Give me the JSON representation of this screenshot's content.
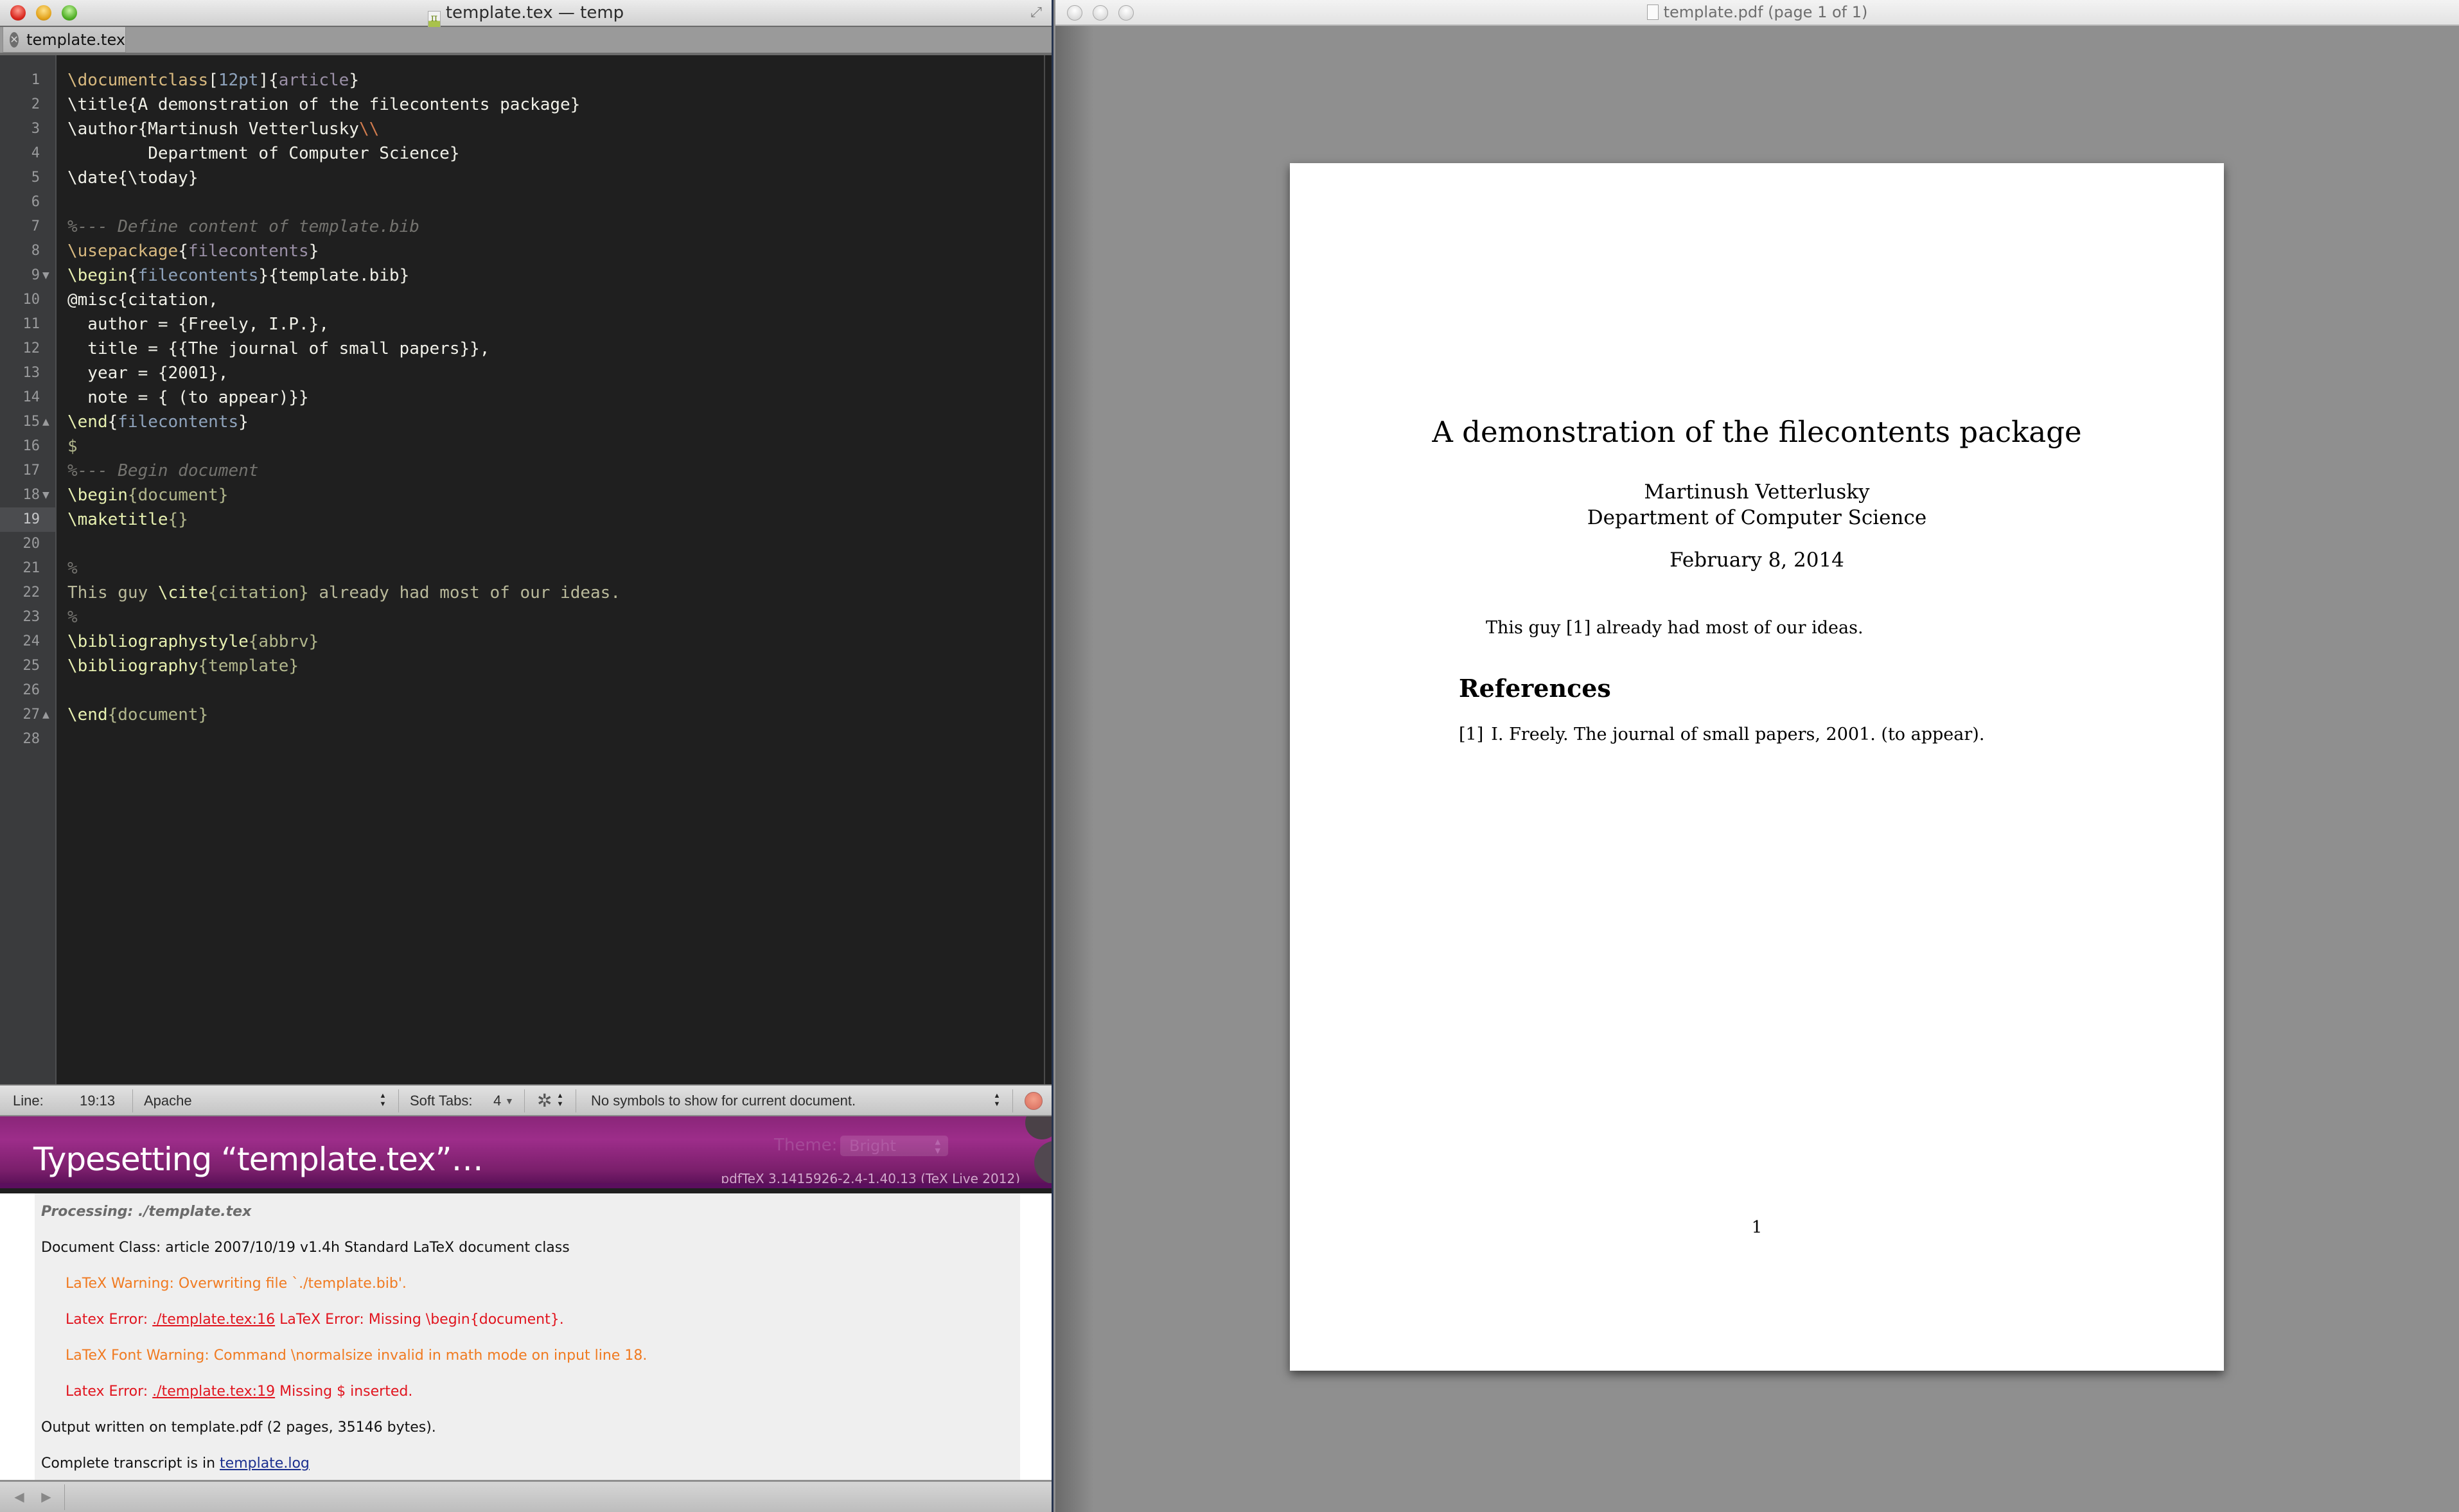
{
  "editor": {
    "window_title": "template.tex — temp",
    "tab_label": "template.tex",
    "active_line": 19,
    "lines": [
      {
        "n": 1,
        "fold": "",
        "parts": [
          [
            "k",
            "\\documentclass"
          ],
          [
            "",
            "["
          ],
          [
            "num",
            "12pt"
          ],
          [
            "",
            "]{"
          ],
          [
            "arg",
            "article"
          ],
          [
            "",
            "}"
          ]
        ]
      },
      {
        "n": 2,
        "fold": "",
        "parts": [
          [
            "",
            "\\title{A demonstration of the filecontents package}"
          ]
        ]
      },
      {
        "n": 3,
        "fold": "",
        "parts": [
          [
            "",
            "\\author{Martinush Vetterlusky"
          ],
          [
            "esc",
            "\\\\"
          ]
        ]
      },
      {
        "n": 4,
        "fold": "",
        "parts": [
          [
            "",
            "        Department of Computer Science}"
          ]
        ]
      },
      {
        "n": 5,
        "fold": "",
        "parts": [
          [
            "",
            "\\date{\\today}"
          ]
        ]
      },
      {
        "n": 6,
        "fold": "",
        "parts": []
      },
      {
        "n": 7,
        "fold": "",
        "parts": [
          [
            "cm",
            "%--- Define content of template.bib"
          ]
        ]
      },
      {
        "n": 8,
        "fold": "",
        "parts": [
          [
            "k",
            "\\usepackage"
          ],
          [
            "",
            "{"
          ],
          [
            "arg",
            "filecontents"
          ],
          [
            "",
            "}"
          ]
        ]
      },
      {
        "n": 9,
        "fold": "down",
        "parts": [
          [
            "kg",
            "\\begin"
          ],
          [
            "",
            "{"
          ],
          [
            "arg2",
            "filecontents"
          ],
          [
            "",
            "}{template.bib}"
          ]
        ]
      },
      {
        "n": 10,
        "fold": "",
        "parts": [
          [
            "",
            "@misc{citation,"
          ]
        ]
      },
      {
        "n": 11,
        "fold": "",
        "parts": [
          [
            "",
            "  author = {Freely, I.P.},"
          ]
        ]
      },
      {
        "n": 12,
        "fold": "",
        "parts": [
          [
            "",
            "  title = {{The journal of small papers}},"
          ]
        ]
      },
      {
        "n": 13,
        "fold": "",
        "parts": [
          [
            "",
            "  year = {2001},"
          ]
        ]
      },
      {
        "n": 14,
        "fold": "",
        "parts": [
          [
            "",
            "  note = { (to appear)}}"
          ]
        ]
      },
      {
        "n": 15,
        "fold": "up",
        "parts": [
          [
            "kg",
            "\\end"
          ],
          [
            "",
            "{"
          ],
          [
            "arg2",
            "filecontents"
          ],
          [
            "",
            "}"
          ]
        ]
      },
      {
        "n": 16,
        "fold": "",
        "parts": [
          [
            "argg",
            "$"
          ]
        ]
      },
      {
        "n": 17,
        "fold": "",
        "parts": [
          [
            "cm",
            "%--- Begin document"
          ]
        ]
      },
      {
        "n": 18,
        "fold": "down",
        "parts": [
          [
            "kg",
            "\\begin"
          ],
          [
            "argg",
            "{document}"
          ]
        ]
      },
      {
        "n": 19,
        "fold": "",
        "parts": [
          [
            "kg",
            "\\maketitle"
          ],
          [
            "argg",
            "{}"
          ]
        ]
      },
      {
        "n": 20,
        "fold": "",
        "parts": []
      },
      {
        "n": 21,
        "fold": "",
        "parts": [
          [
            "pct",
            "%"
          ]
        ]
      },
      {
        "n": 22,
        "fold": "",
        "parts": [
          [
            "txt",
            "This guy "
          ],
          [
            "kg",
            "\\cite"
          ],
          [
            "argg",
            "{citation}"
          ],
          [
            "txt",
            " already had most of our ideas."
          ]
        ]
      },
      {
        "n": 23,
        "fold": "",
        "parts": [
          [
            "pct",
            "%"
          ]
        ]
      },
      {
        "n": 24,
        "fold": "",
        "parts": [
          [
            "kg",
            "\\bibliographystyle"
          ],
          [
            "argg",
            "{abbrv}"
          ]
        ]
      },
      {
        "n": 25,
        "fold": "",
        "parts": [
          [
            "kg",
            "\\bibliography"
          ],
          [
            "argg",
            "{template}"
          ]
        ]
      },
      {
        "n": 26,
        "fold": "",
        "parts": []
      },
      {
        "n": 27,
        "fold": "up",
        "parts": [
          [
            "kg",
            "\\end"
          ],
          [
            "argg",
            "{document}"
          ]
        ]
      },
      {
        "n": 28,
        "fold": "",
        "parts": []
      }
    ]
  },
  "statusbar": {
    "line_label": "Line:",
    "line_value": "19:13",
    "language": "Apache",
    "soft_tabs_label": "Soft Tabs:",
    "soft_tabs_value": "4",
    "symbols": "No symbols to show for current document."
  },
  "typesetting": {
    "title": "Typesetting “template.tex”…",
    "theme_label": "Theme:",
    "theme_value": "Bright",
    "engine_version": "pdfTeX 3.1415926-2.4-1.40.13 (TeX Live 2012)"
  },
  "log": [
    {
      "type": "processing",
      "indent": false,
      "text": "Processing: ./template.tex"
    },
    {
      "type": "normal",
      "indent": false,
      "text": "Document Class: article 2007/10/19 v1.4h Standard LaTeX document class"
    },
    {
      "type": "warning",
      "indent": true,
      "text": "LaTeX Warning: Overwriting file `./template.bib'."
    },
    {
      "type": "error",
      "indent": true,
      "prefix": "Latex Error: ",
      "link": "./template.tex:16",
      "suffix": " LaTeX Error: Missing \\begin{document}."
    },
    {
      "type": "warning",
      "indent": true,
      "text": "LaTeX Font Warning: Command \\normalsize invalid in math mode on input line 18."
    },
    {
      "type": "error",
      "indent": true,
      "prefix": "Latex Error: ",
      "link": "./template.tex:19",
      "suffix": " Missing $ inserted."
    },
    {
      "type": "normal",
      "indent": false,
      "text": "Output written on template.pdf (2 pages, 35146 bytes)."
    },
    {
      "type": "transcript",
      "indent": false,
      "prefix": "Complete transcript is in ",
      "link": "template.log"
    }
  ],
  "pdf": {
    "window_title": "template.pdf (page 1 of 1)",
    "title": "A demonstration of the filecontents package",
    "author": "Martinush Vetterlusky",
    "affiliation": "Department of Computer Science",
    "date": "February 8, 2014",
    "body": "This guy [1] already had most of our ideas.",
    "references_heading": "References",
    "reference_label": "[1]",
    "reference_text": "I. Freely. The journal of small papers, 2001. (to appear).",
    "page_number": "1"
  }
}
